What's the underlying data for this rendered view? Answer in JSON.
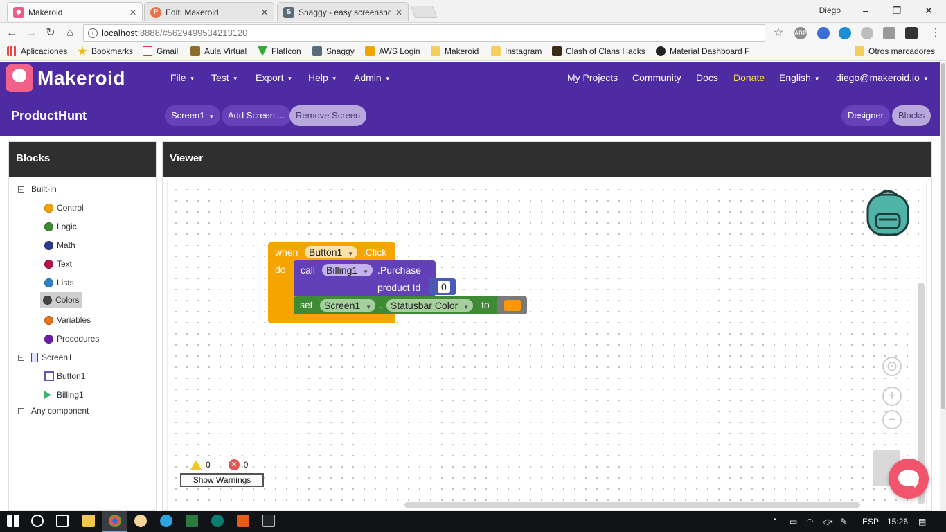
{
  "browser": {
    "tabs": [
      {
        "label": "Makeroid",
        "color": "#ef5c86"
      },
      {
        "label": "Edit: Makeroid",
        "color": "#e8734a"
      },
      {
        "label": "Snaggy - easy screensho",
        "color": "#5b6a79"
      }
    ],
    "user": "Diego",
    "url_host": "localhost",
    "url_rest": ":8888/#5629499534213120",
    "extensions": [
      "ABP"
    ],
    "bookmarks": [
      "Aplicaciones",
      "Bookmarks",
      "Gmail",
      "Aula Virtual",
      "FlatIcon",
      "Snaggy",
      "AWS Login",
      "Makeroid",
      "Instagram",
      "Clash of Clans Hacks",
      "Material Dashboard F"
    ],
    "other_bookmarks": "Otros marcadores"
  },
  "app": {
    "name": "Makeroid",
    "menu": {
      "file": "File",
      "test": "Test",
      "export": "Export",
      "help": "Help",
      "admin": "Admin"
    },
    "right_menu": {
      "my_projects": "My Projects",
      "community": "Community",
      "docs": "Docs",
      "donate": "Donate",
      "language": "English",
      "account": "diego@makeroid.io"
    },
    "project": "ProductHunt",
    "screen_select": "Screen1",
    "add_screen": "Add Screen ...",
    "remove_screen": "Remove Screen",
    "designer": "Designer",
    "blocks_toggle": "Blocks",
    "accent": "#4e2ba3",
    "donate_color": "#f7e24a"
  },
  "blocks_panel": {
    "title": "Blocks",
    "builtin": "Built-in",
    "categories": [
      {
        "label": "Control",
        "color": "#f6a500"
      },
      {
        "label": "Logic",
        "color": "#3e8a35"
      },
      {
        "label": "Math",
        "color": "#2a3b8f"
      },
      {
        "label": "Text",
        "color": "#b3164c"
      },
      {
        "label": "Lists",
        "color": "#2f7fc9"
      },
      {
        "label": "Colors",
        "color": "#444444"
      },
      {
        "label": "Variables",
        "color": "#e8751a"
      },
      {
        "label": "Procedures",
        "color": "#6a1fa8"
      }
    ],
    "screen": "Screen1",
    "components": [
      "Button1",
      "Billing1"
    ],
    "any_component": "Any component"
  },
  "viewer": {
    "title": "Viewer",
    "event_block": {
      "when": "when",
      "component": "Button1",
      "event": ".Click",
      "do": "do"
    },
    "call_block": {
      "call": "call",
      "component": "Billing1",
      "method": ".Purchase",
      "param_label": "product Id",
      "param_value": "0"
    },
    "set_block": {
      "set": "set",
      "component": "Screen1",
      "dot": ".",
      "property": "Statusbar Color",
      "to": "to",
      "color_value": "#ff9800"
    },
    "warnings_count": "0",
    "errors_count": "0",
    "show_warnings": "Show Warnings"
  },
  "taskbar": {
    "language": "ESP",
    "time": "15:26"
  }
}
